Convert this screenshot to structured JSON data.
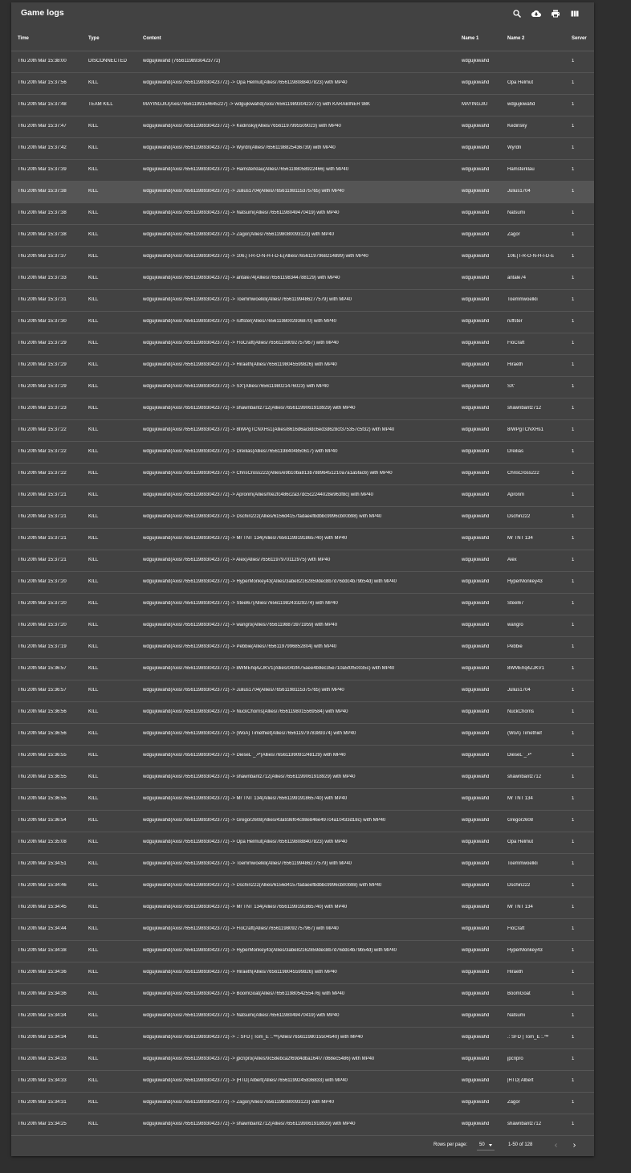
{
  "title": "Game logs",
  "toolbar": {
    "icons": [
      "search-icon",
      "cloud-download-icon",
      "print-icon",
      "view-column-icon"
    ]
  },
  "columns": {
    "time": "Time",
    "type": "Type",
    "content": "Content",
    "name1": "Name 1",
    "name2": "Name 2",
    "server": "Server"
  },
  "rows": [
    {
      "time": "Thu 20th Mar 15:38:00",
      "type": "DISCONNECTED",
      "content": "wdgujkiwahd (76561198930423772)",
      "name1": "wdgujkiwahd",
      "name2": "",
      "server": "1"
    },
    {
      "time": "Thu 20th Mar 15:37:56",
      "type": "KILL",
      "content": "wdgujkiwahd(Axis/76561198930423772) -> Opa Helmut(Allies/76561198088407823) with MP40",
      "name1": "wdgujkiwahd",
      "name2": "Opa Helmut",
      "server": "1"
    },
    {
      "time": "Thu 20th Mar 15:37:48",
      "type": "TEAM KILL",
      "content": "MAYINGJIU(Axis/76561199154645227) -> wdgujkiwahd(Axis/76561198930423772) with KARABINER 98K",
      "name1": "MAYINGJIU",
      "name2": "wdgujkiwahd",
      "server": "1"
    },
    {
      "time": "Thu 20th Mar 15:37:47",
      "type": "KILL",
      "content": "wdgujkiwahd(Axis/76561198930423772) -> Kedinsky(Allies/76561197995509023) with MP40",
      "name1": "wdgujkiwahd",
      "name2": "Kedinsky",
      "server": "1"
    },
    {
      "time": "Thu 20th Mar 15:37:42",
      "type": "KILL",
      "content": "wdgujkiwahd(Axis/76561198930423772) -> Wyrdn(Allies/76561198825436739) with MP40",
      "name1": "wdgujkiwahd",
      "name2": "Wyrdn",
      "server": "1"
    },
    {
      "time": "Thu 20th Mar 15:37:39",
      "type": "KILL",
      "content": "wdgujkiwahd(Axis/76561198930423772) -> Hamsterklau(Allies/76561198058922466) with MP40",
      "name1": "wdgujkiwahd",
      "name2": "Hamsterklau",
      "server": "1"
    },
    {
      "time": "Thu 20th Mar 15:37:38",
      "type": "KILL",
      "content": "wdgujkiwahd(Axis/76561198930423772) -> Julius1704(Allies/76561198115375765) with MP40",
      "name1": "wdgujkiwahd",
      "name2": "Julius1704",
      "server": "1"
    },
    {
      "time": "Thu 20th Mar 15:37:38",
      "type": "KILL",
      "content": "wdgujkiwahd(Axis/76561198930423772) -> Natsumi(Allies/76561198049470419) with MP40",
      "name1": "wdgujkiwahd",
      "name2": "Natsumi",
      "server": "1"
    },
    {
      "time": "Thu 20th Mar 15:37:38",
      "type": "KILL",
      "content": "wdgujkiwahd(Axis/76561198930423772) -> Zagor(Allies/76561198080093123) with MP40",
      "name1": "wdgujkiwahd",
      "name2": "Zagor",
      "server": "1"
    },
    {
      "time": "Thu 20th Mar 15:37:37",
      "type": "KILL",
      "content": "wdgujkiwahd(Axis/76561198930423772) -> 106.| I-R-O-N-H-I-D-E(Allies/76561197968214899) with MP40",
      "name1": "wdgujkiwahd",
      "name2": "106.| I-R-O-N-H-I-D-E",
      "server": "1"
    },
    {
      "time": "Thu 20th Mar 15:37:33",
      "type": "KILL",
      "content": "wdgujkiwahd(Axis/76561198930423772) -> antale74(Allies/76561198344788129) with MP40",
      "name1": "wdgujkiwahd",
      "name2": "antale74",
      "server": "1"
    },
    {
      "time": "Thu 20th Mar 15:37:31",
      "type": "KILL",
      "content": "wdgujkiwahd(Axis/76561198930423772) -> Toemmwoelkli(Allies/76561199486277579) with MP40",
      "name1": "wdgujkiwahd",
      "name2": "Toemmwoelkli",
      "server": "1"
    },
    {
      "time": "Thu 20th Mar 15:37:30",
      "type": "KILL",
      "content": "wdgujkiwahd(Axis/76561198930423772) -> ruffster(Allies/76561198002936870) with MP40",
      "name1": "wdgujkiwahd",
      "name2": "ruffster",
      "server": "1"
    },
    {
      "time": "Thu 20th Mar 15:37:29",
      "type": "KILL",
      "content": "wdgujkiwahd(Axis/76561198930423772) -> FloCraft(Allies/76561198092757967) with MP40",
      "name1": "wdgujkiwahd",
      "name2": "FloCraft",
      "server": "1"
    },
    {
      "time": "Thu 20th Mar 15:37:29",
      "type": "KILL",
      "content": "wdgujkiwahd(Axis/76561198930423772) -> Hiraeth(Allies/76561198045599826) with MP40",
      "name1": "wdgujkiwahd",
      "name2": "Hiraeth",
      "server": "1"
    },
    {
      "time": "Thu 20th Mar 15:37:29",
      "type": "KILL",
      "content": "wdgujkiwahd(Axis/76561198930423772) -> SX'(Allies/76561198021476023) with MP40",
      "name1": "wdgujkiwahd",
      "name2": "SX'",
      "server": "1"
    },
    {
      "time": "Thu 20th Mar 15:37:23",
      "type": "KILL",
      "content": "wdgujkiwahd(Axis/76561198930423772) -> shawnbantz712(Allies/76561199061918929) with MP40",
      "name1": "wdgujkiwahd",
      "name2": "shawnbantz712",
      "server": "1"
    },
    {
      "time": "Thu 20th Mar 15:37:22",
      "type": "KILL",
      "content": "wdgujkiwahd(Axis/76561198930423772) -> 8IWPgTCNXHs1(Allies/8616d6ac8dc6ed3d628cf375357c5f32) with MP40",
      "name1": "wdgujkiwahd",
      "name2": "8IWPgTCNXHs1",
      "server": "1"
    },
    {
      "time": "Thu 20th Mar 15:37:22",
      "type": "KILL",
      "content": "wdgujkiwahd(Axis/76561198930423772) -> Dreilias(Allies/76561198404850617) with MP40",
      "name1": "wdgujkiwahd",
      "name2": "Dreilias",
      "server": "1"
    },
    {
      "time": "Thu 20th Mar 15:37:22",
      "type": "KILL",
      "content": "wdgujkiwahd(Axis/76561198930423772) -> ChrisCross222(Allies/e9b10ba813b78896451210a7a1a5fac6) with MP40",
      "name1": "wdgujkiwahd",
      "name2": "ChrisCross222",
      "server": "1"
    },
    {
      "time": "Thu 20th Mar 15:37:21",
      "type": "KILL",
      "content": "wdgujkiwahd(Axis/76561198930423772) -> Apronm(Allies/f0e2fc486c2a37dc5c2244028e963f8c) with MP40",
      "name1": "wdgujkiwahd",
      "name2": "Apronm",
      "server": "1"
    },
    {
      "time": "Thu 20th Mar 15:37:21",
      "type": "KILL",
      "content": "wdgujkiwahd(Axis/76561198930423772) -> Dschin222(Allies/6156d4157fadaeefbdbbc9996cb00b98) with MP40",
      "name1": "wdgujkiwahd",
      "name2": "Dschin222",
      "server": "1"
    },
    {
      "time": "Thu 20th Mar 15:37:21",
      "type": "KILL",
      "content": "wdgujkiwahd(Axis/76561198930423772) -> Mr TNT 134(Allies/76561199191865740) with MP40",
      "name1": "wdgujkiwahd",
      "name2": "Mr TNT 134",
      "server": "1"
    },
    {
      "time": "Thu 20th Mar 15:37:21",
      "type": "KILL",
      "content": "wdgujkiwahd(Axis/76561198930423772) -> Alex(Allies/76561197970112975) with MP40",
      "name1": "wdgujkiwahd",
      "name2": "Alex",
      "server": "1"
    },
    {
      "time": "Thu 20th Mar 15:37:20",
      "type": "KILL",
      "content": "wdgujkiwahd(Axis/76561198930423772) -> HyperMonkey43(Allies/3abe82162859dec8b7d76ddc4b79b54d) with MP40",
      "name1": "wdgujkiwahd",
      "name2": "HyperMonkey43",
      "server": "1"
    },
    {
      "time": "Thu 20th Mar 15:37:20",
      "type": "KILL",
      "content": "wdgujkiwahd(Axis/76561198930423772) -> Steel67(Allies/76561198243329274) with MP40",
      "name1": "wdgujkiwahd",
      "name2": "Steel67",
      "server": "1"
    },
    {
      "time": "Thu 20th Mar 15:37:20",
      "type": "KILL",
      "content": "wdgujkiwahd(Axis/76561198930423772) -> wangro(Allies/76561198873971959) with MP40",
      "name1": "wdgujkiwahd",
      "name2": "wangro",
      "server": "1"
    },
    {
      "time": "Thu 20th Mar 15:37:19",
      "type": "KILL",
      "content": "wdgujkiwahd(Axis/76561198930423772) -> Pebbie(Allies/76561197996852804) with MP40",
      "name1": "wdgujkiwahd",
      "name2": "Pebbie",
      "server": "1"
    },
    {
      "time": "Thu 20th Mar 15:36:57",
      "type": "KILL",
      "content": "wdgujkiwahd(Axis/76561198930423772) -> 8WMEhq4ZJKV1(Allies/043f475aee4b9ec35e710a5f0f50035c) with MP40",
      "name1": "wdgujkiwahd",
      "name2": "8WMEhq4ZJKV1",
      "server": "1"
    },
    {
      "time": "Thu 20th Mar 15:36:57",
      "type": "KILL",
      "content": "wdgujkiwahd(Axis/76561198930423772) -> Julius1704(Allies/76561198115375765) with MP40",
      "name1": "wdgujkiwahd",
      "name2": "Julius1704",
      "server": "1"
    },
    {
      "time": "Thu 20th Mar 15:36:56",
      "type": "KILL",
      "content": "wdgujkiwahd(Axis/76561198930423772) -> NuckChorris(Allies/76561198015569584) with MP40",
      "name1": "wdgujkiwahd",
      "name2": "NuckChorris",
      "server": "1"
    },
    {
      "time": "Thu 20th Mar 15:36:56",
      "type": "KILL",
      "content": "wdgujkiwahd(Axis/76561198930423772) -> (WoA) Timethief(Allies/76561197978389374) with MP40",
      "name1": "wdgujkiwahd",
      "name2": "(WoA) Timethief",
      "server": "1"
    },
    {
      "time": "Thu 20th Mar 15:36:55",
      "type": "KILL",
      "content": "wdgujkiwahd(Axis/76561198930423772) -> DieseL¨_.•*(Allies/76561199091248129) with MP40",
      "name1": "wdgujkiwahd",
      "name2": "DieseL¨_.•*",
      "server": "1"
    },
    {
      "time": "Thu 20th Mar 15:36:55",
      "type": "KILL",
      "content": "wdgujkiwahd(Axis/76561198930423772) -> shawnbantz712(Allies/76561199061918929) with MP40",
      "name1": "wdgujkiwahd",
      "name2": "shawnbantz712",
      "server": "1"
    },
    {
      "time": "Thu 20th Mar 15:36:55",
      "type": "KILL",
      "content": "wdgujkiwahd(Axis/76561198930423772) -> Mr TNT 134(Allies/76561199191865740) with MP40",
      "name1": "wdgujkiwahd",
      "name2": "Mr TNT 134",
      "server": "1"
    },
    {
      "time": "Thu 20th Mar 15:36:54",
      "type": "KILL",
      "content": "wdgujkiwahd(Axis/76561198930423772) -> Gregor2608(Allies/43a936f04c98e846e497c4a10433d18c) with MP40",
      "name1": "wdgujkiwahd",
      "name2": "Gregor2608",
      "server": "1"
    },
    {
      "time": "Thu 20th Mar 15:35:08",
      "type": "KILL",
      "content": "wdgujkiwahd(Axis/76561198930423772) -> Opa Helmut(Allies/76561198088407823) with MP40",
      "name1": "wdgujkiwahd",
      "name2": "Opa Helmut",
      "server": "1"
    },
    {
      "time": "Thu 20th Mar 15:34:51",
      "type": "KILL",
      "content": "wdgujkiwahd(Axis/76561198930423772) -> Toemmwoelkli(Allies/76561199486277579) with MP40",
      "name1": "wdgujkiwahd",
      "name2": "Toemmwoelkli",
      "server": "1"
    },
    {
      "time": "Thu 20th Mar 15:34:46",
      "type": "KILL",
      "content": "wdgujkiwahd(Axis/76561198930423772) -> Dschin222(Allies/6156d4157fadaeefbdbbc9996cb00b98) with MP40",
      "name1": "wdgujkiwahd",
      "name2": "Dschin222",
      "server": "1"
    },
    {
      "time": "Thu 20th Mar 15:34:45",
      "type": "KILL",
      "content": "wdgujkiwahd(Axis/76561198930423772) -> Mr TNT 134(Allies/76561199191865740) with MP40",
      "name1": "wdgujkiwahd",
      "name2": "Mr TNT 134",
      "server": "1"
    },
    {
      "time": "Thu 20th Mar 15:34:44",
      "type": "KILL",
      "content": "wdgujkiwahd(Axis/76561198930423772) -> FloCraft(Allies/76561198092757967) with MP40",
      "name1": "wdgujkiwahd",
      "name2": "FloCraft",
      "server": "1"
    },
    {
      "time": "Thu 20th Mar 15:34:38",
      "type": "KILL",
      "content": "wdgujkiwahd(Axis/76561198930423772) -> HyperMonkey43(Allies/3abe82162859dec8b7d76ddc4b79b54d) with MP40",
      "name1": "wdgujkiwahd",
      "name2": "HyperMonkey43",
      "server": "1"
    },
    {
      "time": "Thu 20th Mar 15:34:36",
      "type": "KILL",
      "content": "wdgujkiwahd(Axis/76561198930423772) -> Hiraeth(Allies/76561198045599826) with MP40",
      "name1": "wdgujkiwahd",
      "name2": "Hiraeth",
      "server": "1"
    },
    {
      "time": "Thu 20th Mar 15:34:36",
      "type": "KILL",
      "content": "wdgujkiwahd(Axis/76561198930423772) -> BoomGoat(Allies/76561198054255476) with MP40",
      "name1": "wdgujkiwahd",
      "name2": "BoomGoat",
      "server": "1"
    },
    {
      "time": "Thu 20th Mar 15:34:34",
      "type": "KILL",
      "content": "wdgujkiwahd(Axis/76561198930423772) -> Natsumi(Allies/76561198049470419) with MP40",
      "name1": "wdgujkiwahd",
      "name2": "Natsumi",
      "server": "1"
    },
    {
      "time": "Thu 20th Mar 15:34:34",
      "type": "KILL",
      "content": "wdgujkiwahd(Axis/76561198930423772) -> .: SFD | Tom_E :.™(Allies/76561198015504540) with MP40",
      "name1": "wdgujkiwahd",
      "name2": ".: SFD | Tom_E :.™",
      "server": "1"
    },
    {
      "time": "Thu 20th Mar 15:34:33",
      "type": "KILL",
      "content": "wdgujkiwahd(Axis/76561198930423772) -> jpcripro(Allies/9c58ebca2f69d4dba164f77d68ec5486) with MP40",
      "name1": "wdgujkiwahd",
      "name2": "jpcripro",
      "server": "1"
    },
    {
      "time": "Thu 20th Mar 15:34:33",
      "type": "KILL",
      "content": "wdgujkiwahd(Axis/76561198930423772) -> |HTD| Albert(Allies/76561199245836833) with MP40",
      "name1": "wdgujkiwahd",
      "name2": "|HTD| Albert",
      "server": "1"
    },
    {
      "time": "Thu 20th Mar 15:34:31",
      "type": "KILL",
      "content": "wdgujkiwahd(Axis/76561198930423772) -> Zagor(Allies/76561198080093123) with MP40",
      "name1": "wdgujkiwahd",
      "name2": "Zagor",
      "server": "1"
    },
    {
      "time": "Thu 20th Mar 15:34:25",
      "type": "KILL",
      "content": "wdgujkiwahd(Axis/76561198930423772) -> shawnbantz712(Allies/76561199061918929) with MP40",
      "name1": "wdgujkiwahd",
      "name2": "shawnbantz712",
      "server": "1"
    }
  ],
  "highlighted_row": 6,
  "footer": {
    "rows_per_page_label": "Rows per page:",
    "rows_per_page_value": "50",
    "range": "1-50 of 128"
  },
  "colors": {
    "page_background": "#2f2f2f",
    "panel_background": "#424242",
    "highlight_row": "#555555",
    "text": "#ffffff"
  }
}
